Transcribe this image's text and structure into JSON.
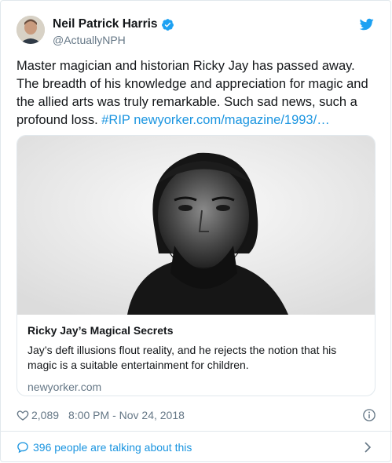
{
  "author": {
    "display_name": "Neil Patrick Harris",
    "handle": "@ActuallyNPH",
    "verified": true,
    "avatar_icon": "user-avatar"
  },
  "tweet": {
    "text": "Master magician and historian Ricky Jay has passed away. The breadth of his knowledge and appreciation for magic and the allied arts was truly remarkable. Such sad news, such a profound loss.",
    "hashtag": "#RIP",
    "link": "newyorker.com/magazine/1993/…"
  },
  "link_card": {
    "title": "Ricky Jay’s Magical Secrets",
    "description": "Jay’s deft illusions flout reality, and he rejects the notion that his magic is a suitable entertainment for children.",
    "domain": "newyorker.com"
  },
  "meta": {
    "likes": "2,089",
    "timestamp": "8:00 PM - Nov 24, 2018"
  },
  "footer": {
    "talking": "396 people are talking about this"
  },
  "colors": {
    "brand_blue": "#1da1f2",
    "link_blue": "#1b95e0",
    "muted": "#657786",
    "border": "#e1e8ed"
  }
}
